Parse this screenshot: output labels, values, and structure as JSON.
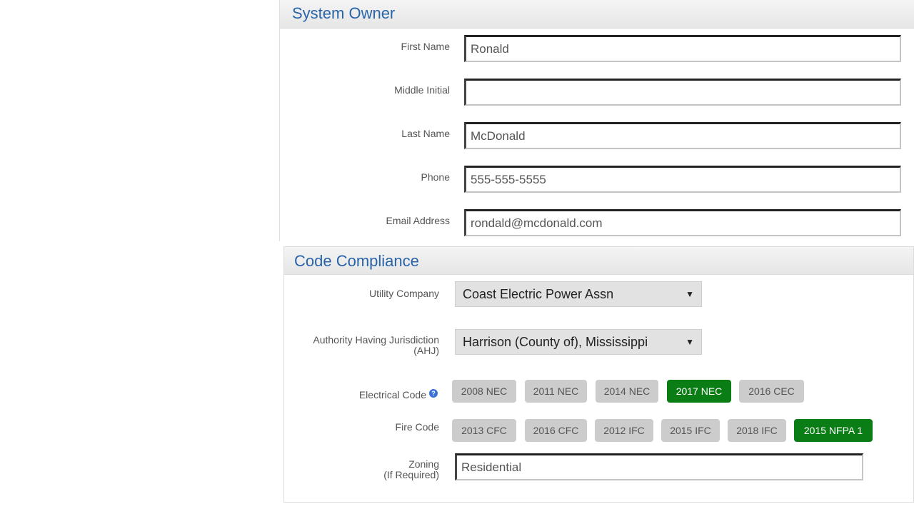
{
  "owner": {
    "title": "System Owner",
    "fields": [
      {
        "label": "First Name",
        "value": "Ronald"
      },
      {
        "label": "Middle Initial",
        "value": ""
      },
      {
        "label": "Last Name",
        "value": "McDonald"
      },
      {
        "label": "Phone",
        "value": "555-555-5555"
      },
      {
        "label": "Email Address",
        "value": "rondald@mcdonald.com"
      }
    ]
  },
  "compliance": {
    "title": "Code Compliance",
    "utility": {
      "label": "Utility Company",
      "value": "Coast Electric Power Assn"
    },
    "ahj": {
      "label_line1": "Authority Having Jurisdiction",
      "label_line2": "(AHJ)",
      "value": "Harrison (County of), Mississippi"
    },
    "electrical": {
      "label": "Electrical Code",
      "help_icon": "?",
      "options": [
        "2008 NEC",
        "2011 NEC",
        "2014 NEC",
        "2017 NEC",
        "2016 CEC"
      ],
      "selected": "2017 NEC"
    },
    "fire": {
      "label": "Fire Code",
      "options": [
        "2013 CFC",
        "2016 CFC",
        "2012 IFC",
        "2015 IFC",
        "2018 IFC",
        "2015 NFPA 1"
      ],
      "selected": "2015 NFPA 1"
    },
    "zoning": {
      "label_line1": "Zoning",
      "label_line2": "(If Required)",
      "value": "Residential"
    }
  },
  "colors": {
    "accent_title": "#2a64a8",
    "active_pill": "#0a7d15",
    "inactive_pill": "#cccccc"
  }
}
